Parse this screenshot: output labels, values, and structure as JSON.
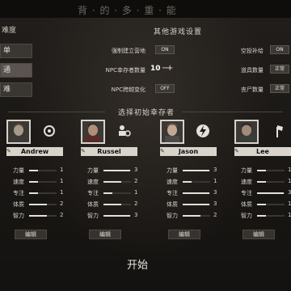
{
  "top": {
    "title": "背 · 的 · 多 · 重 · 能"
  },
  "difficulty": {
    "title": "难度",
    "items": [
      {
        "label": "单"
      },
      {
        "label": "通"
      },
      {
        "label": "难"
      }
    ]
  },
  "other_settings": {
    "title": "其他游戏设置",
    "items": [
      {
        "label": "强制建立营地",
        "value": "ON"
      },
      {
        "label": "NPC幸存者数量",
        "value": "10"
      },
      {
        "label": "NPC跨越变化",
        "value": "OFF"
      }
    ],
    "right_items": [
      {
        "label": "空投补给",
        "value": "ON"
      },
      {
        "label": "道具数量",
        "value": "正常"
      },
      {
        "label": "丧尸数量",
        "value": "正常"
      }
    ],
    "stepper_minus": "−",
    "stepper_plus": "+"
  },
  "survivors": {
    "title": "选择初始幸存者",
    "edit_label": "编辑",
    "list": [
      {
        "name": "Andrew",
        "trait_icon": "gear-cog-icon",
        "stats": [
          {
            "label": "力量",
            "value": 1
          },
          {
            "label": "速度",
            "value": 1
          },
          {
            "label": "专注",
            "value": 1
          },
          {
            "label": "体质",
            "value": 2
          },
          {
            "label": "智力",
            "value": 2
          }
        ]
      },
      {
        "name": "Russel",
        "trait_icon": "person-gear-icon",
        "stats": [
          {
            "label": "力量",
            "value": 3
          },
          {
            "label": "速度",
            "value": 2
          },
          {
            "label": "专注",
            "value": 1
          },
          {
            "label": "体质",
            "value": 2
          },
          {
            "label": "智力",
            "value": 3
          }
        ]
      },
      {
        "name": "Jason",
        "trait_icon": "lightning-icon",
        "stats": [
          {
            "label": "力量",
            "value": 3
          },
          {
            "label": "速度",
            "value": 1
          },
          {
            "label": "专注",
            "value": 3
          },
          {
            "label": "体质",
            "value": 3
          },
          {
            "label": "智力",
            "value": 2
          }
        ]
      },
      {
        "name": "Lee",
        "trait_icon": "axe-icon",
        "stats": [
          {
            "label": "力量",
            "value": 1
          },
          {
            "label": "速度",
            "value": 1
          },
          {
            "label": "专注",
            "value": 3
          },
          {
            "label": "体质",
            "value": 1
          },
          {
            "label": "智力",
            "value": 1
          }
        ]
      }
    ]
  },
  "start_label": "开始",
  "colors": {
    "accent": "#d8d4cc",
    "background": "#1c1a18",
    "bar_fill": "#e4e0d8"
  }
}
